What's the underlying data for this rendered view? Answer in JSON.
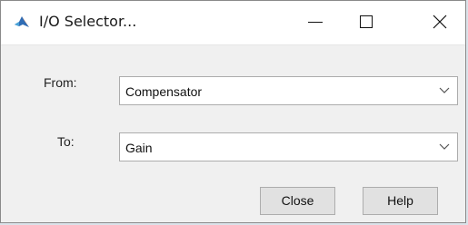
{
  "window": {
    "title": "I/O Selector...",
    "app_icon": "matlab-logo-icon",
    "controls": [
      "minimize-icon",
      "maximize-icon",
      "close-icon"
    ]
  },
  "form": {
    "from_label": "From:",
    "from_value": "Compensator",
    "to_label": "To:",
    "to_value": "Gain"
  },
  "buttons": {
    "close_label": "Close",
    "help_label": "Help"
  },
  "colors": {
    "window_bg": "#f0f0f0",
    "titlebar_bg": "#ffffff",
    "button_bg": "#e1e1e1"
  }
}
